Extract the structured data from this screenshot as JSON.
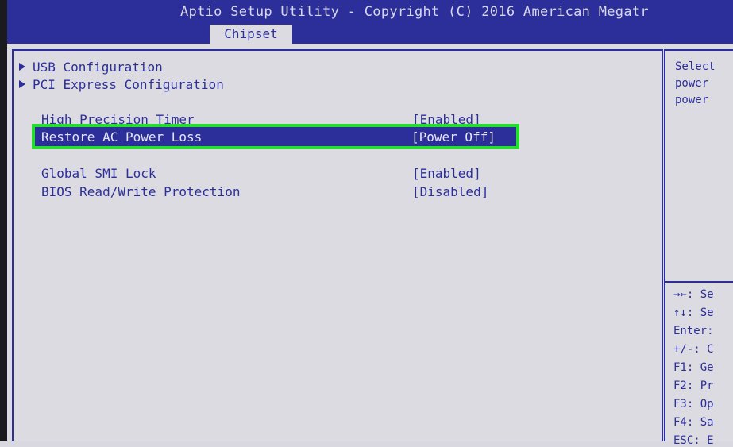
{
  "header": {
    "title": "Aptio Setup Utility - Copyright (C) 2016 American Megatr",
    "active_tab": "Chipset"
  },
  "menu": {
    "submenus": [
      {
        "label": "USB Configuration"
      },
      {
        "label": "PCI Express Configuration"
      }
    ],
    "settings": [
      {
        "label": "High Precision Timer",
        "value": "[Enabled]"
      },
      {
        "label": "Restore AC Power Loss",
        "value": "[Power Off]",
        "selected": true
      },
      {
        "label": "Global SMI Lock",
        "value": "[Enabled]"
      },
      {
        "label": "BIOS Read/Write Protection",
        "value": "[Disabled]"
      }
    ]
  },
  "help": {
    "lines": [
      "Select",
      "power",
      "power"
    ]
  },
  "keys": [
    "→←: Se",
    "↑↓: Se",
    "Enter:",
    "+/-: C",
    "F1: Ge",
    "F2: Pr",
    "F3: Op",
    "F4: Sa",
    "ESC: E"
  ],
  "colors": {
    "bios_blue": "#2c2f9a",
    "background": "#dcdbe2",
    "highlight_outline": "#22e02a"
  }
}
